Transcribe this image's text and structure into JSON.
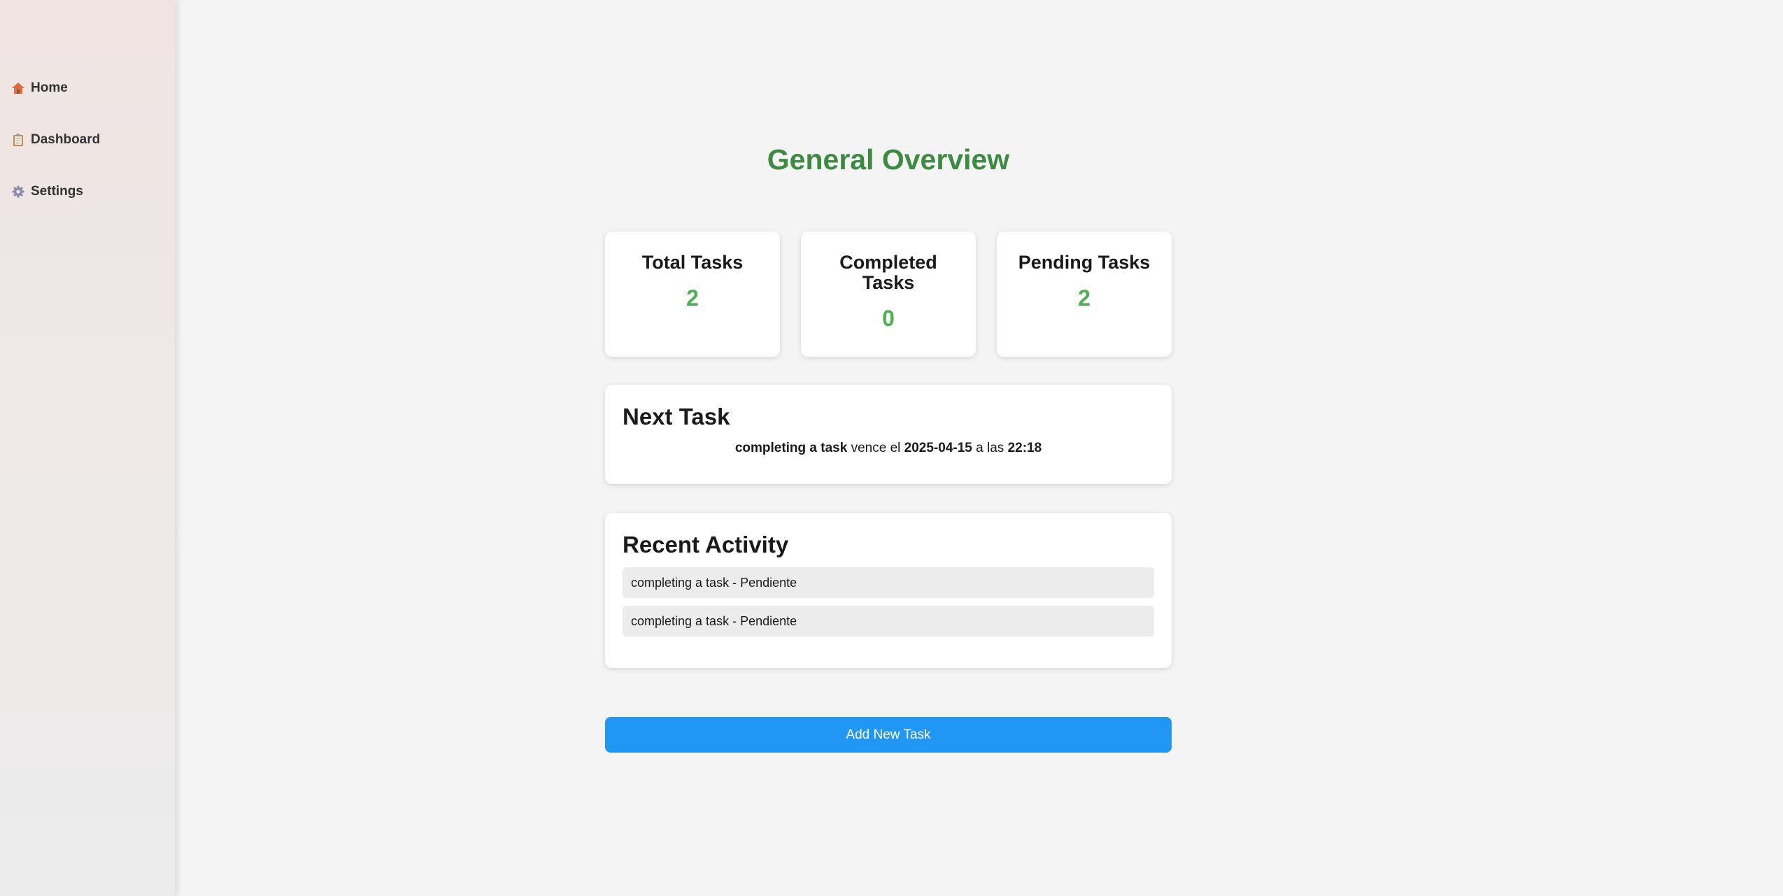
{
  "sidebar": {
    "items": [
      {
        "label": "Home",
        "icon": "home-icon"
      },
      {
        "label": "Dashboard",
        "icon": "clipboard-icon"
      },
      {
        "label": "Settings",
        "icon": "gear-icon"
      }
    ]
  },
  "main": {
    "title": "General Overview",
    "stats": [
      {
        "label": "Total Tasks",
        "value": "2"
      },
      {
        "label": "Completed Tasks",
        "value": "0"
      },
      {
        "label": "Pending Tasks",
        "value": "2"
      }
    ],
    "next_task": {
      "heading": "Next Task",
      "task_name": "completing a task",
      "due_text": "vence el",
      "date": "2025-04-15",
      "at_text": "a las",
      "time": "22:18"
    },
    "recent_activity": {
      "heading": "Recent Activity",
      "items": [
        "completing a task - Pendiente",
        "completing a task - Pendiente"
      ]
    },
    "add_button_label": "Add New Task"
  },
  "colors": {
    "title": "#3d8b40",
    "stat_value": "#4caf50",
    "button": "#2196f3",
    "background": "#f4f4f4"
  }
}
